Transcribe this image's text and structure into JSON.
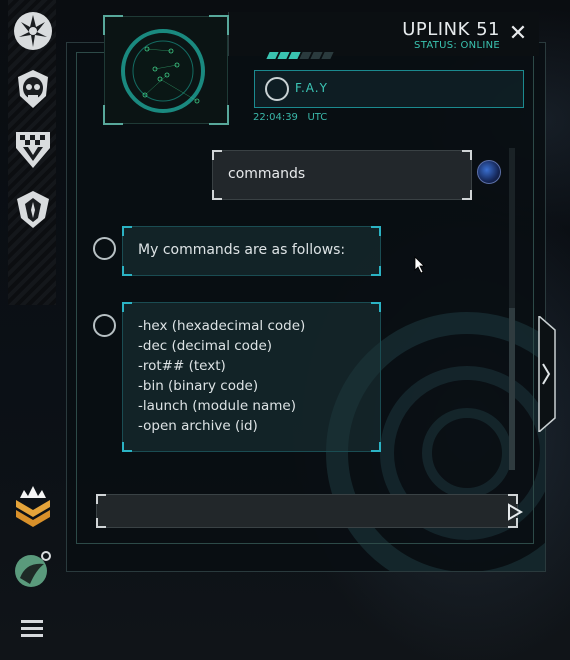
{
  "header": {
    "title": "UPLINK 51",
    "status": "STATUS: ONLINE"
  },
  "contact": {
    "name": "F.A.Y",
    "time": "22:04:39",
    "timezone": "UTC"
  },
  "messages": {
    "user": "commands",
    "bot_intro": "My commands are as follows:",
    "bot_commands": [
      "-hex (hexadecimal code)",
      "-dec (decimal code)",
      "-rot## (text)",
      "-bin (binary code)",
      "-launch (module name)",
      "-open archive (id)"
    ]
  },
  "input": {
    "placeholder": "",
    "value": ""
  },
  "sidebar": {
    "items": [
      "lightning-emblem-icon",
      "skull-emblem-icon",
      "checkered-v-emblem-icon",
      "shield-emblem-icon",
      "rank-chevrons-icon",
      "planet-icon",
      "menu-icon"
    ]
  },
  "colors": {
    "accent_teal": "#3ac3b0",
    "frame_cyan": "#2bb3c4",
    "rank_gold": "#e5a43a"
  }
}
